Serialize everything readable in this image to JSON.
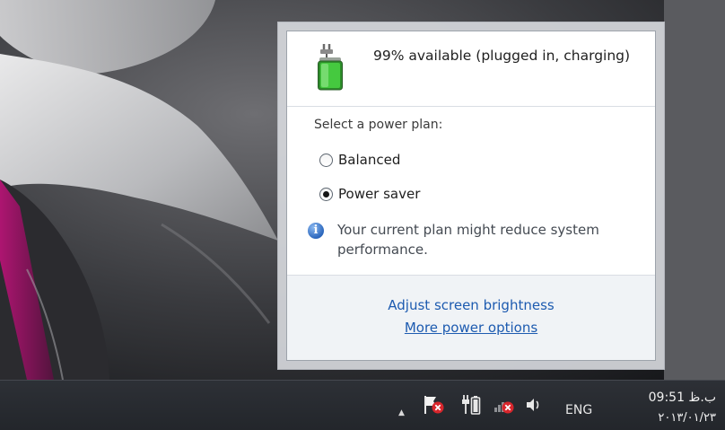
{
  "power_flyout": {
    "battery_status": "99% available (plugged in, charging)",
    "battery_percent": 99,
    "plan_heading": "Select a power plan:",
    "plans": [
      {
        "label": "Balanced",
        "selected": false
      },
      {
        "label": "Power saver",
        "selected": true
      }
    ],
    "info_icon_glyph": "i",
    "info_message": "Your current plan might reduce system performance.",
    "links": {
      "brightness": "Adjust screen brightness",
      "more_options": "More power options"
    }
  },
  "taskbar": {
    "tray_icons": [
      "show-hidden-icons-chevron",
      "action-center-flag-icon",
      "power-plug-icon",
      "network-disconnected-icon",
      "volume-icon"
    ],
    "chevron_glyph": "▲",
    "language": "ENG",
    "clock": {
      "time": "09:51 ب.ظ",
      "date": "۲۰۱۳/۰۱/۲۳"
    }
  },
  "colors": {
    "link": "#1d5bb0",
    "battery_fill": "#3fbf3a",
    "taskbar": "#2a2d32",
    "error_red": "#d8262c"
  }
}
